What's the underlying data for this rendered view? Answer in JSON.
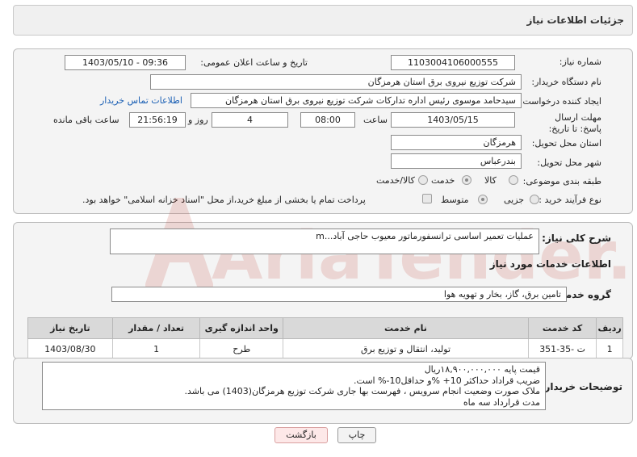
{
  "header": {
    "title": "جزئیات اطلاعات نیاز"
  },
  "form": {
    "need_number_label": "شماره نیاز:",
    "need_number": "1103004106000555",
    "announce_label": "تاریخ و ساعت اعلان عمومی:",
    "announce_value": "1403/05/10 - 09:36",
    "buyer_org_label": "نام دستگاه خریدار:",
    "buyer_org": "شرکت توزیع نیروی برق استان هرمزگان",
    "creator_label": "ایجاد کننده درخواست:",
    "creator": "سیدحامد موسوی رئیس اداره تدارکات شرکت توزیع نیروی برق استان هرمزگان",
    "contact_link": "اطلاعات تماس خریدار",
    "deadline_label": "مهلت ارسال پاسخ: تا تاریخ:",
    "deadline_date": "1403/05/15",
    "time_label": "ساعت",
    "deadline_time": "08:00",
    "days_value": "4",
    "days_label": "روز و",
    "remaining_time": "21:56:19",
    "remaining_label": "ساعت باقی مانده",
    "province_label": "استان محل تحویل:",
    "province": "هرمزگان",
    "city_label": "شهر محل تحویل:",
    "city": "بندرعباس",
    "category_label": "طبقه بندی موضوعی:",
    "category_options": [
      "کالا",
      "خدمت",
      "کالا/خدمت"
    ],
    "category_selected": "خدمت",
    "process_label": "نوع فرآیند خرید :",
    "process_options": [
      "جزیی",
      "متوسط"
    ],
    "process_selected": "متوسط",
    "payment_note": "پرداخت تمام یا بخشی از مبلغ خرید،از محل \"اسناد خزانه اسلامی\" خواهد بود."
  },
  "summary": {
    "label": "شرح کلی نیاز:",
    "text": "عملیات تعمیر اساسی ترانسفورماتور معیوب حاجی آباد...m"
  },
  "services": {
    "section_title": "اطلاعات خدمات مورد نیاز",
    "group_label": "گروه خدمت:",
    "group_value": "تامین برق، گاز، بخار و تهویه هوا",
    "columns": [
      "ردیف",
      "کد خدمت",
      "نام خدمت",
      "واحد اندازه گیری",
      "تعداد / مقدار",
      "تاریخ نیاز"
    ],
    "rows": [
      [
        "1",
        "ت -35-351",
        "تولید، انتقال و توزیع برق",
        "طرح",
        "1",
        "1403/08/30"
      ]
    ]
  },
  "buyer_notes": {
    "label": "توضیحات خریدار:",
    "lines": [
      "قیمت پایه ۱۸,۹۰۰,۰۰۰,۰۰۰ریال",
      "ضریب قراداد حداکثر 10+ %و حداقل10-% است.",
      "ملاک صورت وضعیت انجام سرویس ، فهرست بها جاری شرکت توزیع هرمزگان(1403) می باشد.",
      "مدت قرارداد سه  ماه"
    ]
  },
  "buttons": {
    "print": "چاپ",
    "back": "بازگشت"
  },
  "watermark": {
    "text": "AriaTender.neT"
  },
  "colors": {
    "link": "#1a5fb4",
    "back_button_bg": "#fde8e8",
    "watermark": "#c0392b"
  }
}
